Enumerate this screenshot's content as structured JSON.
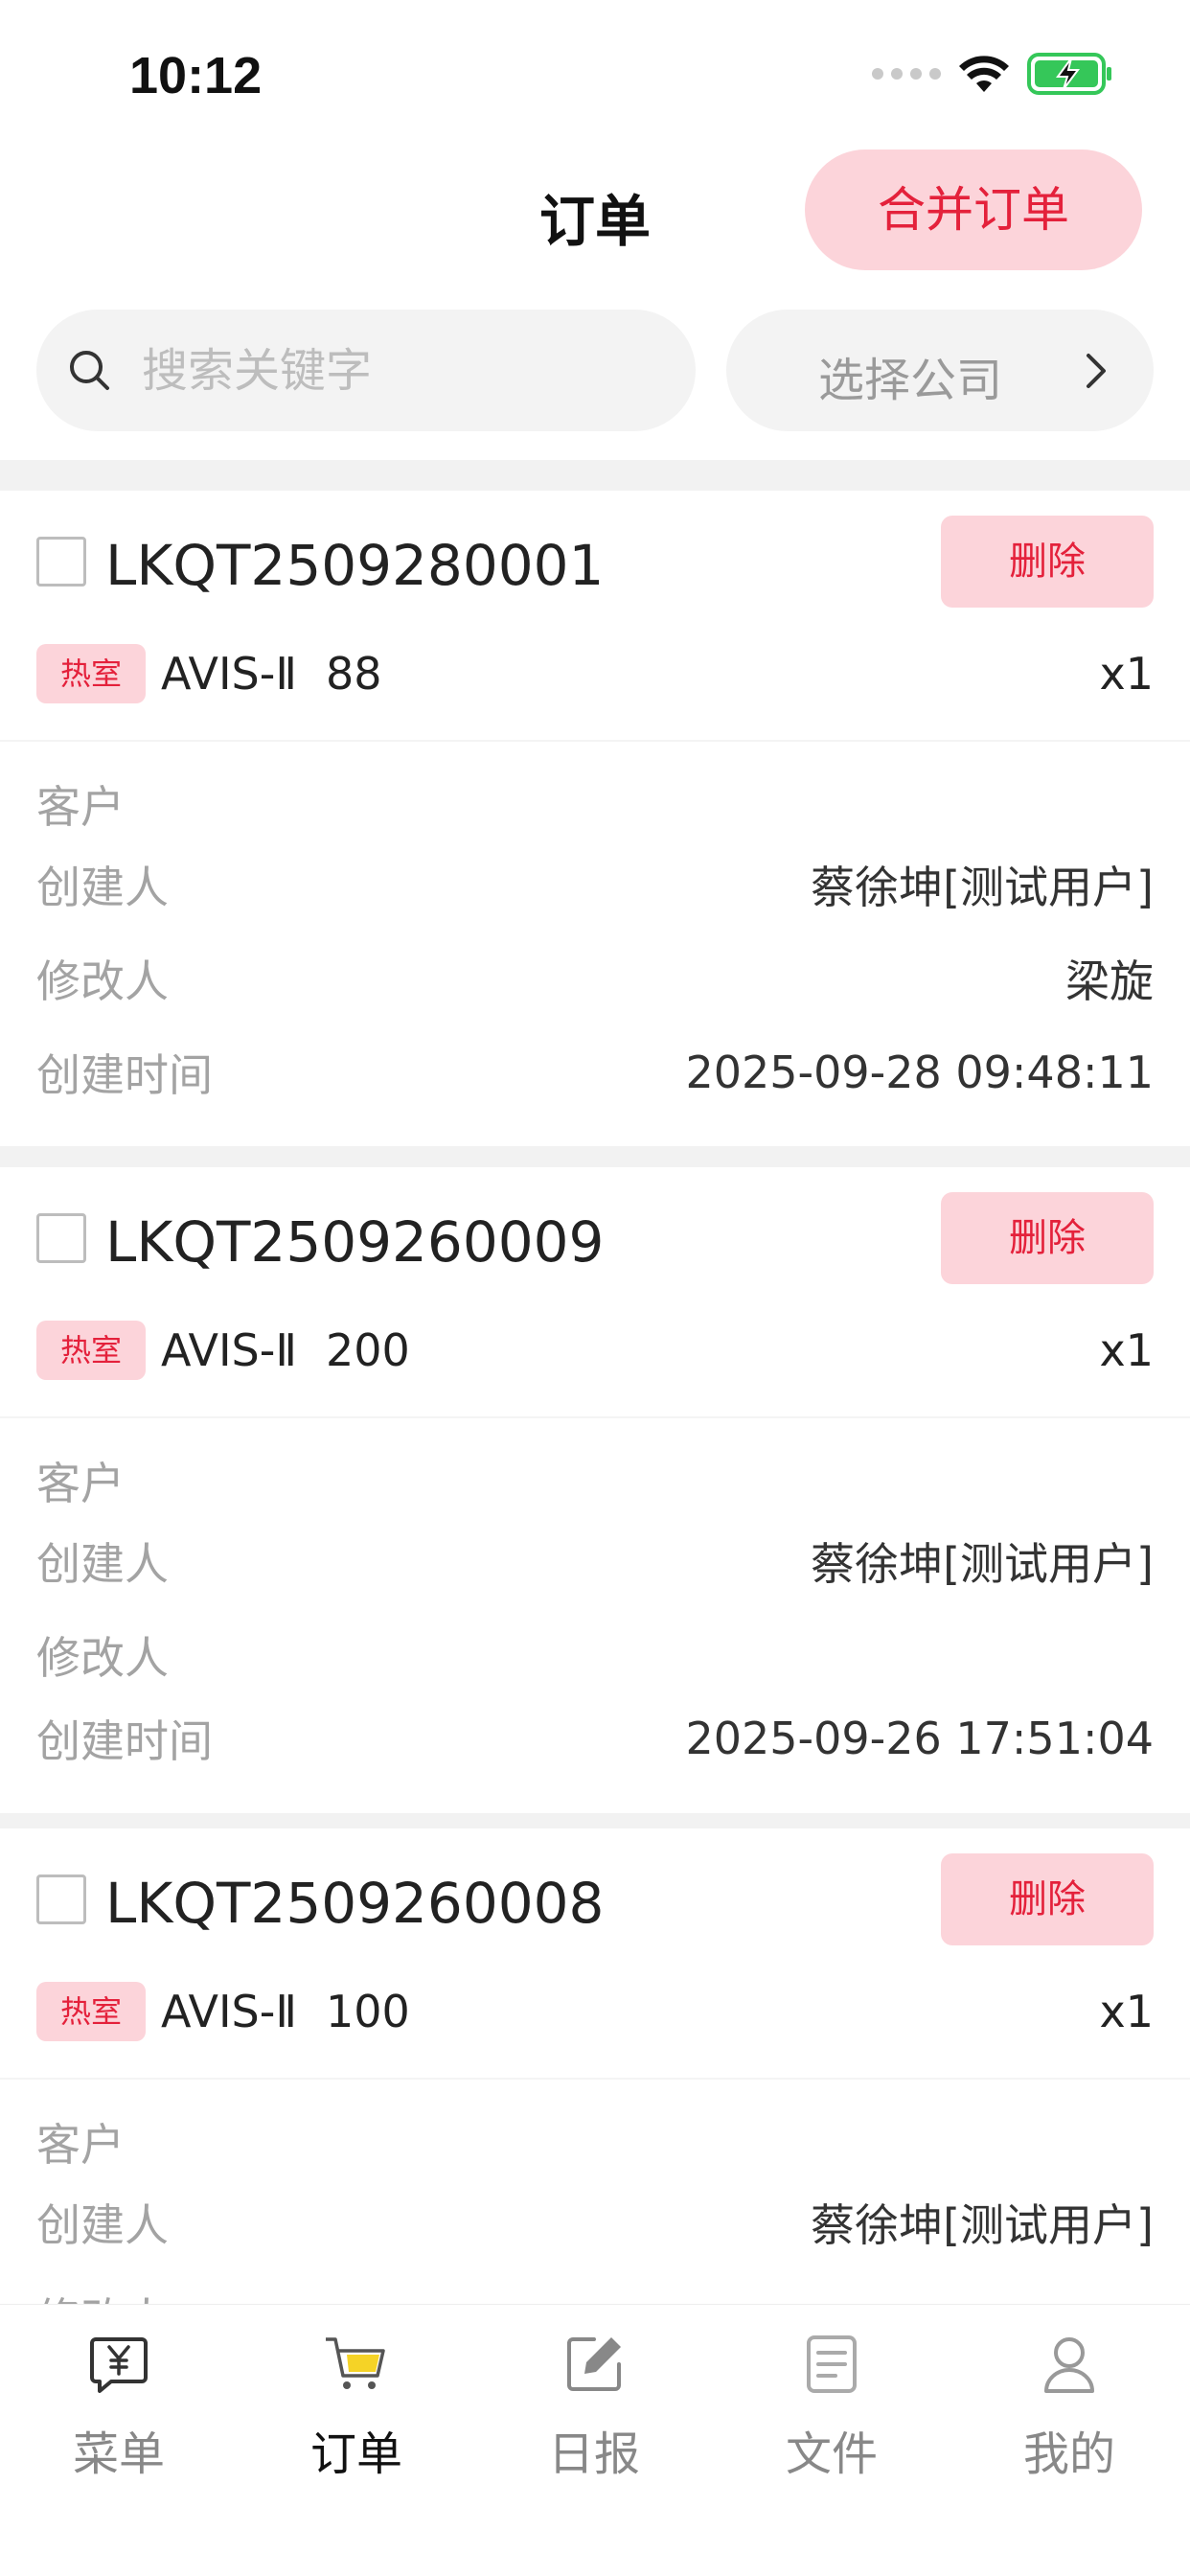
{
  "status_bar": {
    "time": "10:12"
  },
  "header": {
    "title": "订单",
    "merge_button": "合并订单"
  },
  "search": {
    "placeholder": "搜索关键字",
    "company_select": "选择公司"
  },
  "orders": [
    {
      "order_no": "LKQT2509280001",
      "delete_label": "删除",
      "tag": "热室",
      "product_name": "AVIS-Ⅱ",
      "product_spec": "88",
      "quantity": "x1",
      "customer_label": "客户",
      "customer_value": "",
      "creator_label": "创建人",
      "creator_value": "蔡徐坤[测试用户]",
      "modifier_label": "修改人",
      "modifier_value": "梁旋",
      "created_at_label": "创建时间",
      "created_at_value": "2025-09-28 09:48:11"
    },
    {
      "order_no": "LKQT2509260009",
      "delete_label": "删除",
      "tag": "热室",
      "product_name": "AVIS-Ⅱ",
      "product_spec": "200",
      "quantity": "x1",
      "customer_label": "客户",
      "customer_value": "",
      "creator_label": "创建人",
      "creator_value": "蔡徐坤[测试用户]",
      "modifier_label": "修改人",
      "modifier_value": "",
      "created_at_label": "创建时间",
      "created_at_value": "2025-09-26 17:51:04"
    },
    {
      "order_no": "LKQT2509260008",
      "delete_label": "删除",
      "tag": "热室",
      "product_name": "AVIS-Ⅱ",
      "product_spec": "100",
      "quantity": "x1",
      "customer_label": "客户",
      "customer_value": "",
      "creator_label": "创建人",
      "creator_value": "蔡徐坤[测试用户]",
      "modifier_label": "修改人",
      "modifier_value": ""
    }
  ],
  "tab_bar": {
    "items": [
      {
        "label": "菜单",
        "icon": "menu-yen-icon"
      },
      {
        "label": "订单",
        "icon": "cart-icon",
        "active": true
      },
      {
        "label": "日报",
        "icon": "edit-report-icon"
      },
      {
        "label": "文件",
        "icon": "document-icon"
      },
      {
        "label": "我的",
        "icon": "user-icon"
      }
    ]
  },
  "colors": {
    "accent": "#e4213b",
    "accent_bg": "#fcd4da",
    "battery": "#35c759"
  }
}
